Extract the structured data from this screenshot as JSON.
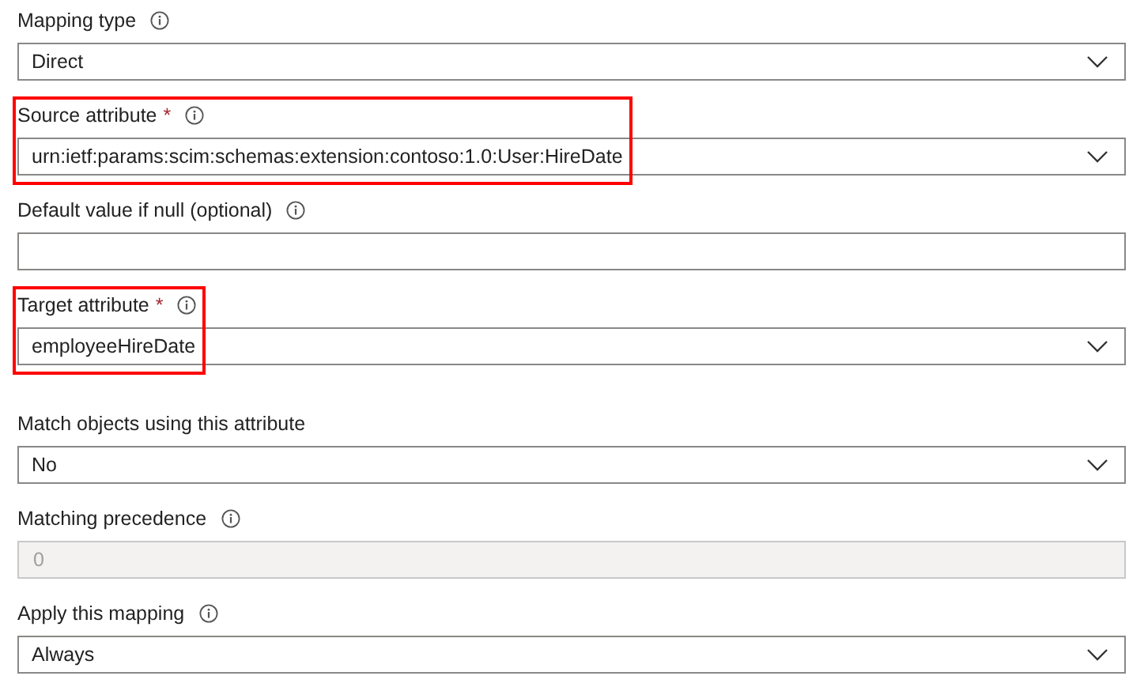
{
  "sections": [
    [
      {
        "label": "Mapping type",
        "info": true,
        "kind": "dropdown",
        "value": "Direct",
        "disabled": false,
        "highlighted": false
      },
      {
        "label": "Source attribute",
        "asterisk": "*",
        "info": true,
        "kind": "dropdown",
        "value": "urn:ietf:params:scim:schemas:extension:contoso:1.0:User:HireDate",
        "disabled": false,
        "highlighted": true
      },
      {
        "label": "Default value if null (optional)",
        "info": true,
        "kind": "text",
        "disabled": false,
        "highlighted": false
      },
      {
        "label": "Target attribute",
        "asterisk": "*",
        "info": true,
        "kind": "dropdown",
        "value": "employeeHireDate",
        "disabled": false,
        "highlighted": true
      }
    ],
    [
      {
        "label": "Match objects using this attribute",
        "info": false,
        "kind": "dropdown",
        "value": "No",
        "disabled": false,
        "highlighted": false
      },
      {
        "label": "Matching precedence",
        "info": true,
        "kind": "text",
        "value": "0",
        "disabled": true,
        "highlighted": false
      },
      {
        "label": "Apply this mapping",
        "info": true,
        "kind": "dropdown",
        "value": "Always",
        "disabled": false,
        "highlighted": false
      }
    ]
  ]
}
